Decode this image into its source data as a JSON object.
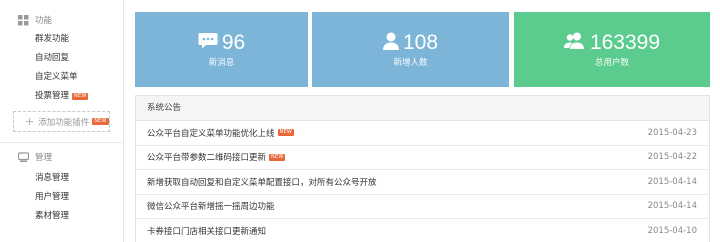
{
  "sidebar": {
    "section_features": {
      "label": "功能",
      "icon": "grid-icon"
    },
    "feature_items": [
      {
        "label": "群发功能",
        "badge": ""
      },
      {
        "label": "自动回复",
        "badge": ""
      },
      {
        "label": "自定义菜单",
        "badge": ""
      },
      {
        "label": "投票管理",
        "badge": "NEW"
      }
    ],
    "add_plugin": {
      "label": "添加功能插件",
      "badge": "NEW"
    },
    "section_manage": {
      "label": "管理",
      "icon": "monitor-icon"
    },
    "manage_items": [
      {
        "label": "消息管理"
      },
      {
        "label": "用户管理"
      },
      {
        "label": "素材管理"
      }
    ]
  },
  "stats": [
    {
      "value": "96",
      "label": "新消息",
      "icon": "chat-bubble-icon",
      "color": "#7db5d9"
    },
    {
      "value": "108",
      "label": "新增人数",
      "icon": "person-icon",
      "color": "#7db5d9"
    },
    {
      "value": "163399",
      "label": "总用户数",
      "icon": "users-icon",
      "color": "#5bcc8e"
    }
  ],
  "notices": {
    "title": "系统公告",
    "items": [
      {
        "text": "公众平台自定义菜单功能优化上线",
        "badge": "NEW",
        "date": "2015-04-23"
      },
      {
        "text": "公众平台带参数二维码接口更新",
        "badge": "NEW",
        "date": "2015-04-22"
      },
      {
        "text": "新增获取自动回复和自定义菜单配置接口，对所有公众号开放",
        "badge": "",
        "date": "2015-04-14"
      },
      {
        "text": "微信公众平台新增摇一摇周边功能",
        "badge": "",
        "date": "2015-04-14"
      },
      {
        "text": "卡券接口门店相关接口更新通知",
        "badge": "",
        "date": "2015-04-10"
      }
    ]
  },
  "colors": {
    "badge": "#e8683a",
    "blue_card": "#7db5d9",
    "green_card": "#5bcc8e"
  }
}
